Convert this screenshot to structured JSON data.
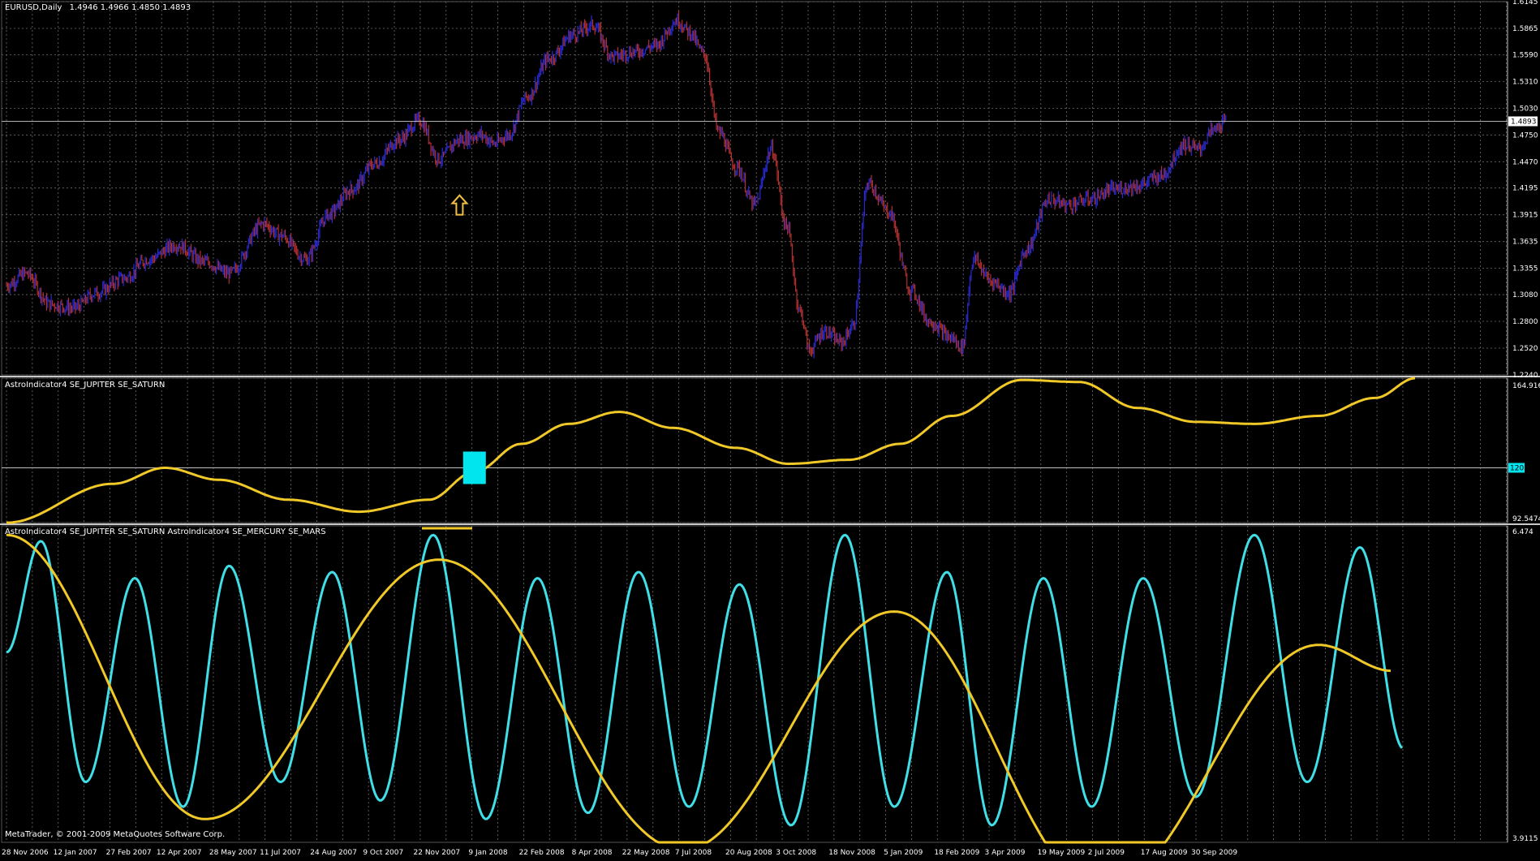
{
  "window": {
    "symbol_label": "EURUSD,Daily",
    "ohlc_label": "1.4946 1.4966 1.4850 1.4893",
    "copyright": "MetaTrader, © 2001-2009 MetaQuotes Software Corp."
  },
  "colors": {
    "background": "#000000",
    "grid": "#6e6e6e",
    "bar_up": "#2a2ad0",
    "bar_down": "#b03030",
    "jupiter_saturn": "#f0c828",
    "mercury_mars": "#40dfe8",
    "marker": "#00e5ee",
    "arrow": "#f0c040",
    "separator": "#c8c8c8"
  },
  "chart_data": [
    {
      "type": "line",
      "panel": "price",
      "title": "EURUSD,Daily",
      "series": [
        {
          "name": "EURUSD,Daily",
          "x": [
            "2006-11-28",
            "2006-12-15",
            "2007-01-05",
            "2007-01-25",
            "2007-02-15",
            "2007-03-10",
            "2007-04-01",
            "2007-04-25",
            "2007-05-20",
            "2007-06-10",
            "2007-07-10",
            "2007-07-25",
            "2007-08-16",
            "2007-09-05",
            "2007-09-25",
            "2007-10-15",
            "2007-11-05",
            "2007-11-23",
            "2007-12-10",
            "2007-12-28",
            "2008-01-15",
            "2008-01-28",
            "2008-02-08",
            "2008-02-25",
            "2008-03-15",
            "2008-04-05",
            "2008-04-22",
            "2008-05-10",
            "2008-05-28",
            "2008-06-15",
            "2008-07-05",
            "2008-07-15",
            "2008-07-28",
            "2008-08-10",
            "2008-08-25",
            "2008-09-10",
            "2008-09-25",
            "2008-10-08",
            "2008-10-20",
            "2008-10-28",
            "2008-11-10",
            "2008-11-25",
            "2008-12-05",
            "2008-12-18",
            "2009-01-05",
            "2009-01-25",
            "2009-02-10",
            "2009-02-28",
            "2009-03-10",
            "2009-03-20",
            "2009-04-05",
            "2009-04-20",
            "2009-05-05",
            "2009-05-25",
            "2009-06-10",
            "2009-06-30",
            "2009-07-20",
            "2009-08-10",
            "2009-08-30",
            "2009-09-20",
            "2009-10-02",
            "2009-10-15",
            "2009-10-26"
          ],
          "values": [
            1.318,
            1.33,
            1.298,
            1.294,
            1.31,
            1.325,
            1.345,
            1.36,
            1.342,
            1.33,
            1.382,
            1.37,
            1.345,
            1.392,
            1.418,
            1.445,
            1.47,
            1.49,
            1.45,
            1.47,
            1.475,
            1.466,
            1.475,
            1.515,
            1.555,
            1.58,
            1.59,
            1.557,
            1.562,
            1.568,
            1.595,
            1.583,
            1.56,
            1.478,
            1.442,
            1.402,
            1.46,
            1.38,
            1.29,
            1.25,
            1.27,
            1.258,
            1.275,
            1.425,
            1.395,
            1.312,
            1.28,
            1.263,
            1.253,
            1.345,
            1.322,
            1.31,
            1.355,
            1.408,
            1.402,
            1.408,
            1.418,
            1.422,
            1.432,
            1.465,
            1.46,
            1.48,
            1.489
          ]
        }
      ],
      "current_price_label": "1.4893",
      "ylim": [
        1.224,
        1.6145
      ],
      "y_ticks": [
        "1.6145",
        "1.5865",
        "1.5590",
        "1.5310",
        "1.5030",
        "1.4750",
        "1.4470",
        "1.4195",
        "1.3915",
        "1.3635",
        "1.3355",
        "1.3080",
        "1.2800",
        "1.2520",
        "1.2240"
      ]
    },
    {
      "type": "line",
      "panel": "indicator1",
      "title": "AstroIndicator4 SE_JUPITER SE_SATURN",
      "series": [
        {
          "name": "AstroIndicator4 SE_JUPITER SE_SATURN",
          "x": [
            "2006-11-28",
            "2007-03-01",
            "2007-04-15",
            "2007-06-01",
            "2007-08-01",
            "2007-10-01",
            "2007-12-01",
            "2008-01-10",
            "2008-02-20",
            "2008-04-01",
            "2008-05-15",
            "2008-07-01",
            "2008-08-25",
            "2008-10-10",
            "2008-12-01",
            "2009-01-15",
            "2009-03-01",
            "2009-05-01",
            "2009-06-20",
            "2009-08-10",
            "2009-09-30",
            "2009-11-20",
            "2010-01-15",
            "2010-03-05",
            "2010-04-10"
          ],
          "values": [
            92.5,
            112,
            120,
            114,
            104,
            98,
            104,
            118,
            132,
            142,
            148,
            140,
            130,
            122,
            124,
            132,
            146,
            164,
            163,
            150,
            143,
            142,
            146,
            155,
            165
          ]
        }
      ],
      "ylim": [
        92.5474,
        164.916
      ],
      "reference_level": 120,
      "reference_label": "120",
      "y_ticks": [
        "164.916",
        "92.5474"
      ],
      "marker": {
        "x": "2008-01-10",
        "value": 120
      }
    },
    {
      "type": "line",
      "panel": "indicator2",
      "title": "AstroIndicator4 SE_JUPITER SE_SATURN  AstroIndicator4 SE_MERCURY SE_MARS",
      "series": [
        {
          "name": "AstroIndicator4 SE_JUPITER SE_SATURN",
          "x": [
            "2006-11-28",
            "2007-05-20",
            "2007-12-10",
            "2008-07-10",
            "2009-01-10",
            "2009-07-10",
            "2010-01-15",
            "2010-03-20"
          ],
          "values": [
            6.4,
            4.1,
            6.2,
            3.85,
            5.78,
            3.52,
            5.51,
            5.3
          ]
        },
        {
          "name": "AstroIndicator4 SE_MERCURY SE_MARS",
          "x": [
            "2006-11-28",
            "2006-12-28",
            "2007-02-05",
            "2007-03-20",
            "2007-05-01",
            "2007-06-10",
            "2007-07-25",
            "2007-09-08",
            "2007-10-20",
            "2007-12-05",
            "2008-01-20",
            "2008-03-05",
            "2008-04-18",
            "2008-06-01",
            "2008-07-15",
            "2008-08-28",
            "2008-10-12",
            "2008-11-28",
            "2009-01-10",
            "2009-02-25",
            "2009-04-05",
            "2009-05-20",
            "2009-07-01",
            "2009-08-15",
            "2009-09-30",
            "2009-11-20",
            "2010-01-05",
            "2010-02-20",
            "2010-03-30"
          ],
          "values": [
            5.45,
            6.35,
            4.4,
            6.05,
            4.2,
            6.15,
            4.4,
            6.1,
            4.25,
            6.4,
            4.1,
            6.05,
            4.15,
            6.1,
            4.2,
            6.0,
            4.05,
            6.4,
            4.2,
            6.1,
            4.05,
            6.05,
            4.2,
            6.05,
            4.28,
            6.4,
            4.4,
            6.3,
            4.67
          ]
        }
      ],
      "ylim": [
        3.9115,
        6.474
      ],
      "y_ticks": [
        "6.474",
        "3.9115"
      ]
    }
  ],
  "x_axis": {
    "ticks": [
      {
        "date": "2006-11-28",
        "label": "28 Nov 2006"
      },
      {
        "date": "2007-01-12",
        "label": "12 Jan 2007"
      },
      {
        "date": "2007-02-27",
        "label": "27 Feb 2007"
      },
      {
        "date": "2007-04-12",
        "label": "12 Apr 2007"
      },
      {
        "date": "2007-05-28",
        "label": "28 May 2007"
      },
      {
        "date": "2007-07-11",
        "label": "11 Jul 2007"
      },
      {
        "date": "2007-08-24",
        "label": "24 Aug 2007"
      },
      {
        "date": "2007-10-09",
        "label": "9 Oct 2007"
      },
      {
        "date": "2007-11-22",
        "label": "22 Nov 2007"
      },
      {
        "date": "2008-01-09",
        "label": "9 Jan 2008"
      },
      {
        "date": "2008-02-22",
        "label": "22 Feb 2008"
      },
      {
        "date": "2008-04-08",
        "label": "8 Apr 2008"
      },
      {
        "date": "2008-05-22",
        "label": "22 May 2008"
      },
      {
        "date": "2008-07-07",
        "label": "7 Jul 2008"
      },
      {
        "date": "2008-08-20",
        "label": "20 Aug 2008"
      },
      {
        "date": "2008-10-03",
        "label": "3 Oct 2008"
      },
      {
        "date": "2008-11-18",
        "label": "18 Nov 2008"
      },
      {
        "date": "2009-01-05",
        "label": "5 Jan 2009"
      },
      {
        "date": "2009-02-18",
        "label": "18 Feb 2009"
      },
      {
        "date": "2009-04-03",
        "label": "3 Apr 2009"
      },
      {
        "date": "2009-05-19",
        "label": "19 May 2009"
      },
      {
        "date": "2009-07-02",
        "label": "2 Jul 2009"
      },
      {
        "date": "2009-08-17",
        "label": "17 Aug 2009"
      },
      {
        "date": "2009-09-30",
        "label": "30 Sep 2009"
      }
    ]
  }
}
